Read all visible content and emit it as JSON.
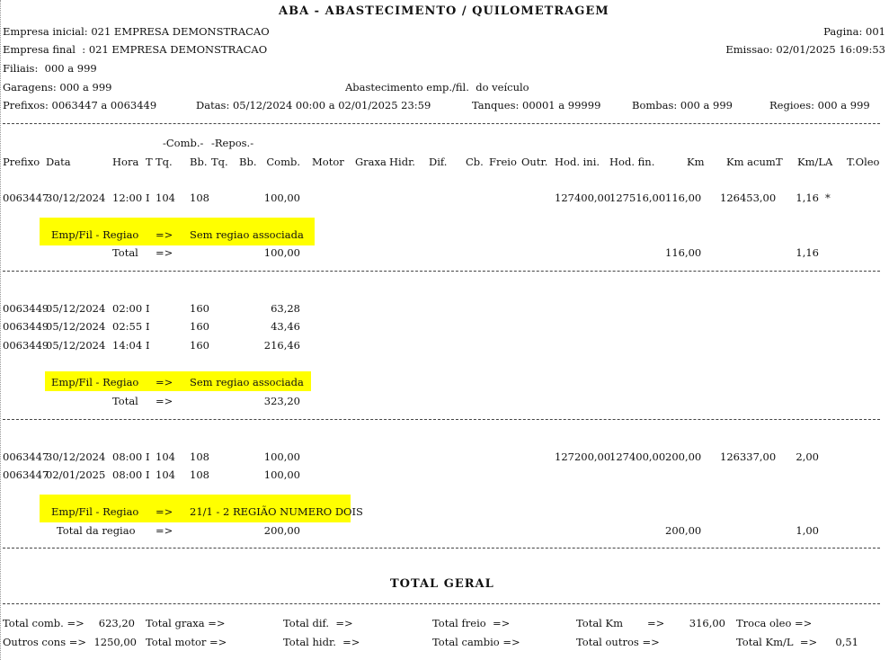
{
  "report": {
    "title": "ABA - ABASTECIMENTO / QUILOMETRAGEM",
    "subtitle": "Abastecimento emp./fil.  do veículo",
    "empresa_inicial": "Empresa inicial: 021 EMPRESA DEMONSTRACAO",
    "empresa_final": "Empresa final  : 021 EMPRESA DEMONSTRACAO",
    "filiais": "Filiais:  000 a 999",
    "garagens": "Garagens: 000 a 999",
    "prefixos": "Prefixos: 0063447 a 0063449",
    "datas": "Datas: 05/12/2024 00:00 a 02/01/2025 23:59",
    "tanques": "Tanques: 00001 a 99999",
    "bombas": "Bombas: 000 a 999",
    "regioes": "Regioes: 000 a 999",
    "pagina": "Pagina: 001",
    "emissao": "Emissao: 02/01/2025 16:09:53"
  },
  "header": {
    "group_comb": "-Comb.-",
    "group_repos": "-Repos.-",
    "cols": {
      "prefixo": "Prefixo",
      "data": "Data",
      "hora": "Hora",
      "t": "T",
      "tq": "Tq.",
      "bb": "Bb.",
      "tq2": "Tq.",
      "bb2": "Bb.",
      "comb": "Comb.",
      "motor": "Motor",
      "graxa": "Graxa",
      "hidr": "Hidr.",
      "dif": "Dif.",
      "cb": "Cb.",
      "freio": "Freio",
      "outr": "Outr.",
      "hod_ini": "Hod. ini.",
      "hod_fin": "Hod. fin.",
      "km": "Km",
      "km_acum": "Km acum.",
      "t2": "T",
      "kml": "Km/L",
      "a": "A",
      "toleo": "T.Oleo"
    },
    "underline": "------- ----------  -----  - ---  --- ---  ---  ---  ----------  -----  -----  -----  -----  ----  -----  -----  -----------  -----------  ------  ----------  -  ------  -  ------"
  },
  "groups": [
    {
      "rows": [
        {
          "prefixo": "0063447",
          "data": "30/12/2024",
          "hora": "12:00",
          "t": "I",
          "tq": "104",
          "bb": "108",
          "comb": "100,00",
          "hod_ini": "127400,00",
          "hod_fin": "127516,00",
          "km": "116,00",
          "km_acum": "126453,00",
          "kml": "1,16",
          "a": "*"
        }
      ],
      "regiao_label": "Emp/Fil - Regiao",
      "regiao_arrow": "=>",
      "regiao_value": "Sem regiao associada",
      "total_label": "Total",
      "total_arrow": "=>",
      "total_comb": "100,00",
      "total_km": "116,00",
      "total_kml": "1,16"
    },
    {
      "rows": [
        {
          "prefixo": "0063449",
          "data": "05/12/2024",
          "hora": "02:00",
          "t": "I",
          "tq": "",
          "bb": "160",
          "comb": "63,28"
        },
        {
          "prefixo": "0063449",
          "data": "05/12/2024",
          "hora": "02:55",
          "t": "I",
          "tq": "",
          "bb": "160",
          "comb": "43,46"
        },
        {
          "prefixo": "0063449",
          "data": "05/12/2024",
          "hora": "14:04",
          "t": "I",
          "tq": "",
          "bb": "160",
          "comb": "216,46"
        }
      ],
      "regiao_label": "Emp/Fil - Regiao",
      "regiao_arrow": "=>",
      "regiao_value": "Sem regiao associada",
      "total_label": "Total",
      "total_arrow": "=>",
      "total_comb": "323,20"
    },
    {
      "rows": [
        {
          "prefixo": "0063447",
          "data": "30/12/2024",
          "hora": "08:00",
          "t": "I",
          "tq": "104",
          "bb": "108",
          "comb": "100,00",
          "hod_ini": "127200,00",
          "hod_fin": "127400,00",
          "km": "200,00",
          "km_acum": "126337,00",
          "kml": "2,00"
        },
        {
          "prefixo": "0063447",
          "data": "02/01/2025",
          "hora": "08:00",
          "t": "I",
          "tq": "104",
          "bb": "108",
          "comb": "100,00"
        }
      ],
      "regiao_label": "Emp/Fil - Regiao",
      "regiao_arrow": "=>",
      "regiao_value": "21/1 - 2 REGIÃO NUMERO DOIS",
      "total_label": "Total da regiao",
      "total_arrow": "=>",
      "total_comb": "200,00",
      "total_km": "200,00",
      "total_kml": "1,00"
    }
  ],
  "total_geral": {
    "title": "TOTAL GERAL",
    "line1": {
      "comb_label": "Total comb. =>",
      "comb_value": "623,20",
      "graxa_label": "Total graxa =>",
      "dif_label": "Total dif.  =>",
      "freio_label": "Total freio  =>",
      "km_label": "Total Km",
      "km_arrow": "=>",
      "km_value": "316,00",
      "troca_label": "Troca oleo =>"
    },
    "line2": {
      "outros_label": "Outros cons =>",
      "outros_value": "1250,00",
      "motor_label": "Total motor =>",
      "hidr_label": "Total hidr.  =>",
      "cambio_label": "Total cambio =>",
      "outros2_label": "Total outros =>",
      "kml_label": "Total Km/L  =>",
      "kml_value": "0,51"
    }
  }
}
